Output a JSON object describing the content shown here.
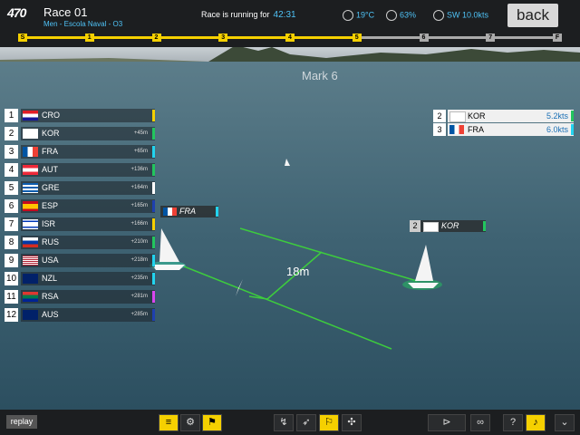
{
  "header": {
    "logo": "470",
    "race_title": "Race 01",
    "race_subtitle": "Men - Escola Naval - O3",
    "status_label": "Race is running for",
    "elapsed": "42:31",
    "temperature": "19°C",
    "humidity": "63%",
    "wind": "SW 10.0kts",
    "back_label": "back"
  },
  "progress": {
    "markers": [
      "S",
      "1",
      "2",
      "3",
      "4",
      "5",
      "6",
      "7",
      "F"
    ],
    "completed_through": 5,
    "colors": {
      "done": "#f5d000",
      "todo": "#aaaaaa"
    }
  },
  "scene": {
    "mark_label": "Mark 6",
    "distance_label": "18m"
  },
  "ranking": [
    {
      "pos": "1",
      "code": "CRO",
      "gap": "",
      "color": "#f5d000",
      "flag": "cro"
    },
    {
      "pos": "2",
      "code": "KOR",
      "gap": "+45m",
      "color": "#22c55e",
      "flag": "kor"
    },
    {
      "pos": "3",
      "code": "FRA",
      "gap": "+65m",
      "color": "#22d3ee",
      "flag": "fra"
    },
    {
      "pos": "4",
      "code": "AUT",
      "gap": "+136m",
      "color": "#22c55e",
      "flag": "aut"
    },
    {
      "pos": "5",
      "code": "GRE",
      "gap": "+164m",
      "color": "#ffffff",
      "flag": "gre"
    },
    {
      "pos": "6",
      "code": "ESP",
      "gap": "+165m",
      "color": "#1e40af",
      "flag": "esp"
    },
    {
      "pos": "7",
      "code": "ISR",
      "gap": "+166m",
      "color": "#f5d000",
      "flag": "isr"
    },
    {
      "pos": "8",
      "code": "RUS",
      "gap": "+210m",
      "color": "#22c55e",
      "flag": "rus"
    },
    {
      "pos": "9",
      "code": "USA",
      "gap": "+218m",
      "color": "#22d3ee",
      "flag": "usa"
    },
    {
      "pos": "10",
      "code": "NZL",
      "gap": "+235m",
      "color": "#22d3ee",
      "flag": "nzl"
    },
    {
      "pos": "11",
      "code": "RSA",
      "gap": "+281m",
      "color": "#d946ef",
      "flag": "rsa"
    },
    {
      "pos": "12",
      "code": "AUS",
      "gap": "+285m",
      "color": "#1e40af",
      "flag": "aus"
    }
  ],
  "followed": [
    {
      "pos": "2",
      "code": "KOR",
      "speed": "5.2kts",
      "color": "#22c55e",
      "flag": "kor"
    },
    {
      "pos": "3",
      "code": "FRA",
      "speed": "6.0kts",
      "color": "#22d3ee",
      "flag": "fra"
    }
  ],
  "boat_tags": {
    "fra": {
      "code": "FRA",
      "color": "#22d3ee"
    },
    "kor": {
      "pos": "2",
      "code": "KOR",
      "color": "#22c55e"
    }
  },
  "bottom": {
    "replay_label": "replay",
    "tool_icons": [
      "list-icon",
      "boat-gear-icon",
      "wind-flag-icon",
      "course-icon",
      "heading-icon",
      "flag-icon",
      "crosshair-icon",
      "camera-boat-icon",
      "binoculars-icon",
      "help-icon",
      "sound-icon",
      "collapse-icon"
    ]
  }
}
